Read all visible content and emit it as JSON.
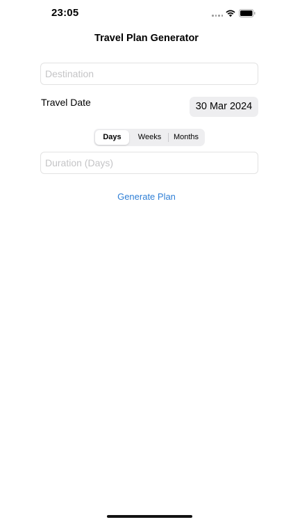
{
  "status_bar": {
    "time": "23:05",
    "icons": [
      "signal-dots-icon",
      "wifi-icon",
      "battery-icon"
    ]
  },
  "nav": {
    "title": "Travel Plan Generator"
  },
  "form": {
    "destination": {
      "placeholder": "Destination",
      "value": ""
    },
    "travel_date": {
      "label": "Travel Date",
      "value": "30 Mar 2024"
    },
    "duration_unit": {
      "options": [
        "Days",
        "Weeks",
        "Months"
      ],
      "selected": "Days"
    },
    "duration": {
      "placeholder": "Duration (Days)",
      "value": ""
    },
    "generate_label": "Generate Plan"
  },
  "colors": {
    "accent": "#2f7fd6",
    "field_border": "#e2e2e2",
    "control_bg": "#eeeef0",
    "placeholder": "#c4c4c6"
  }
}
